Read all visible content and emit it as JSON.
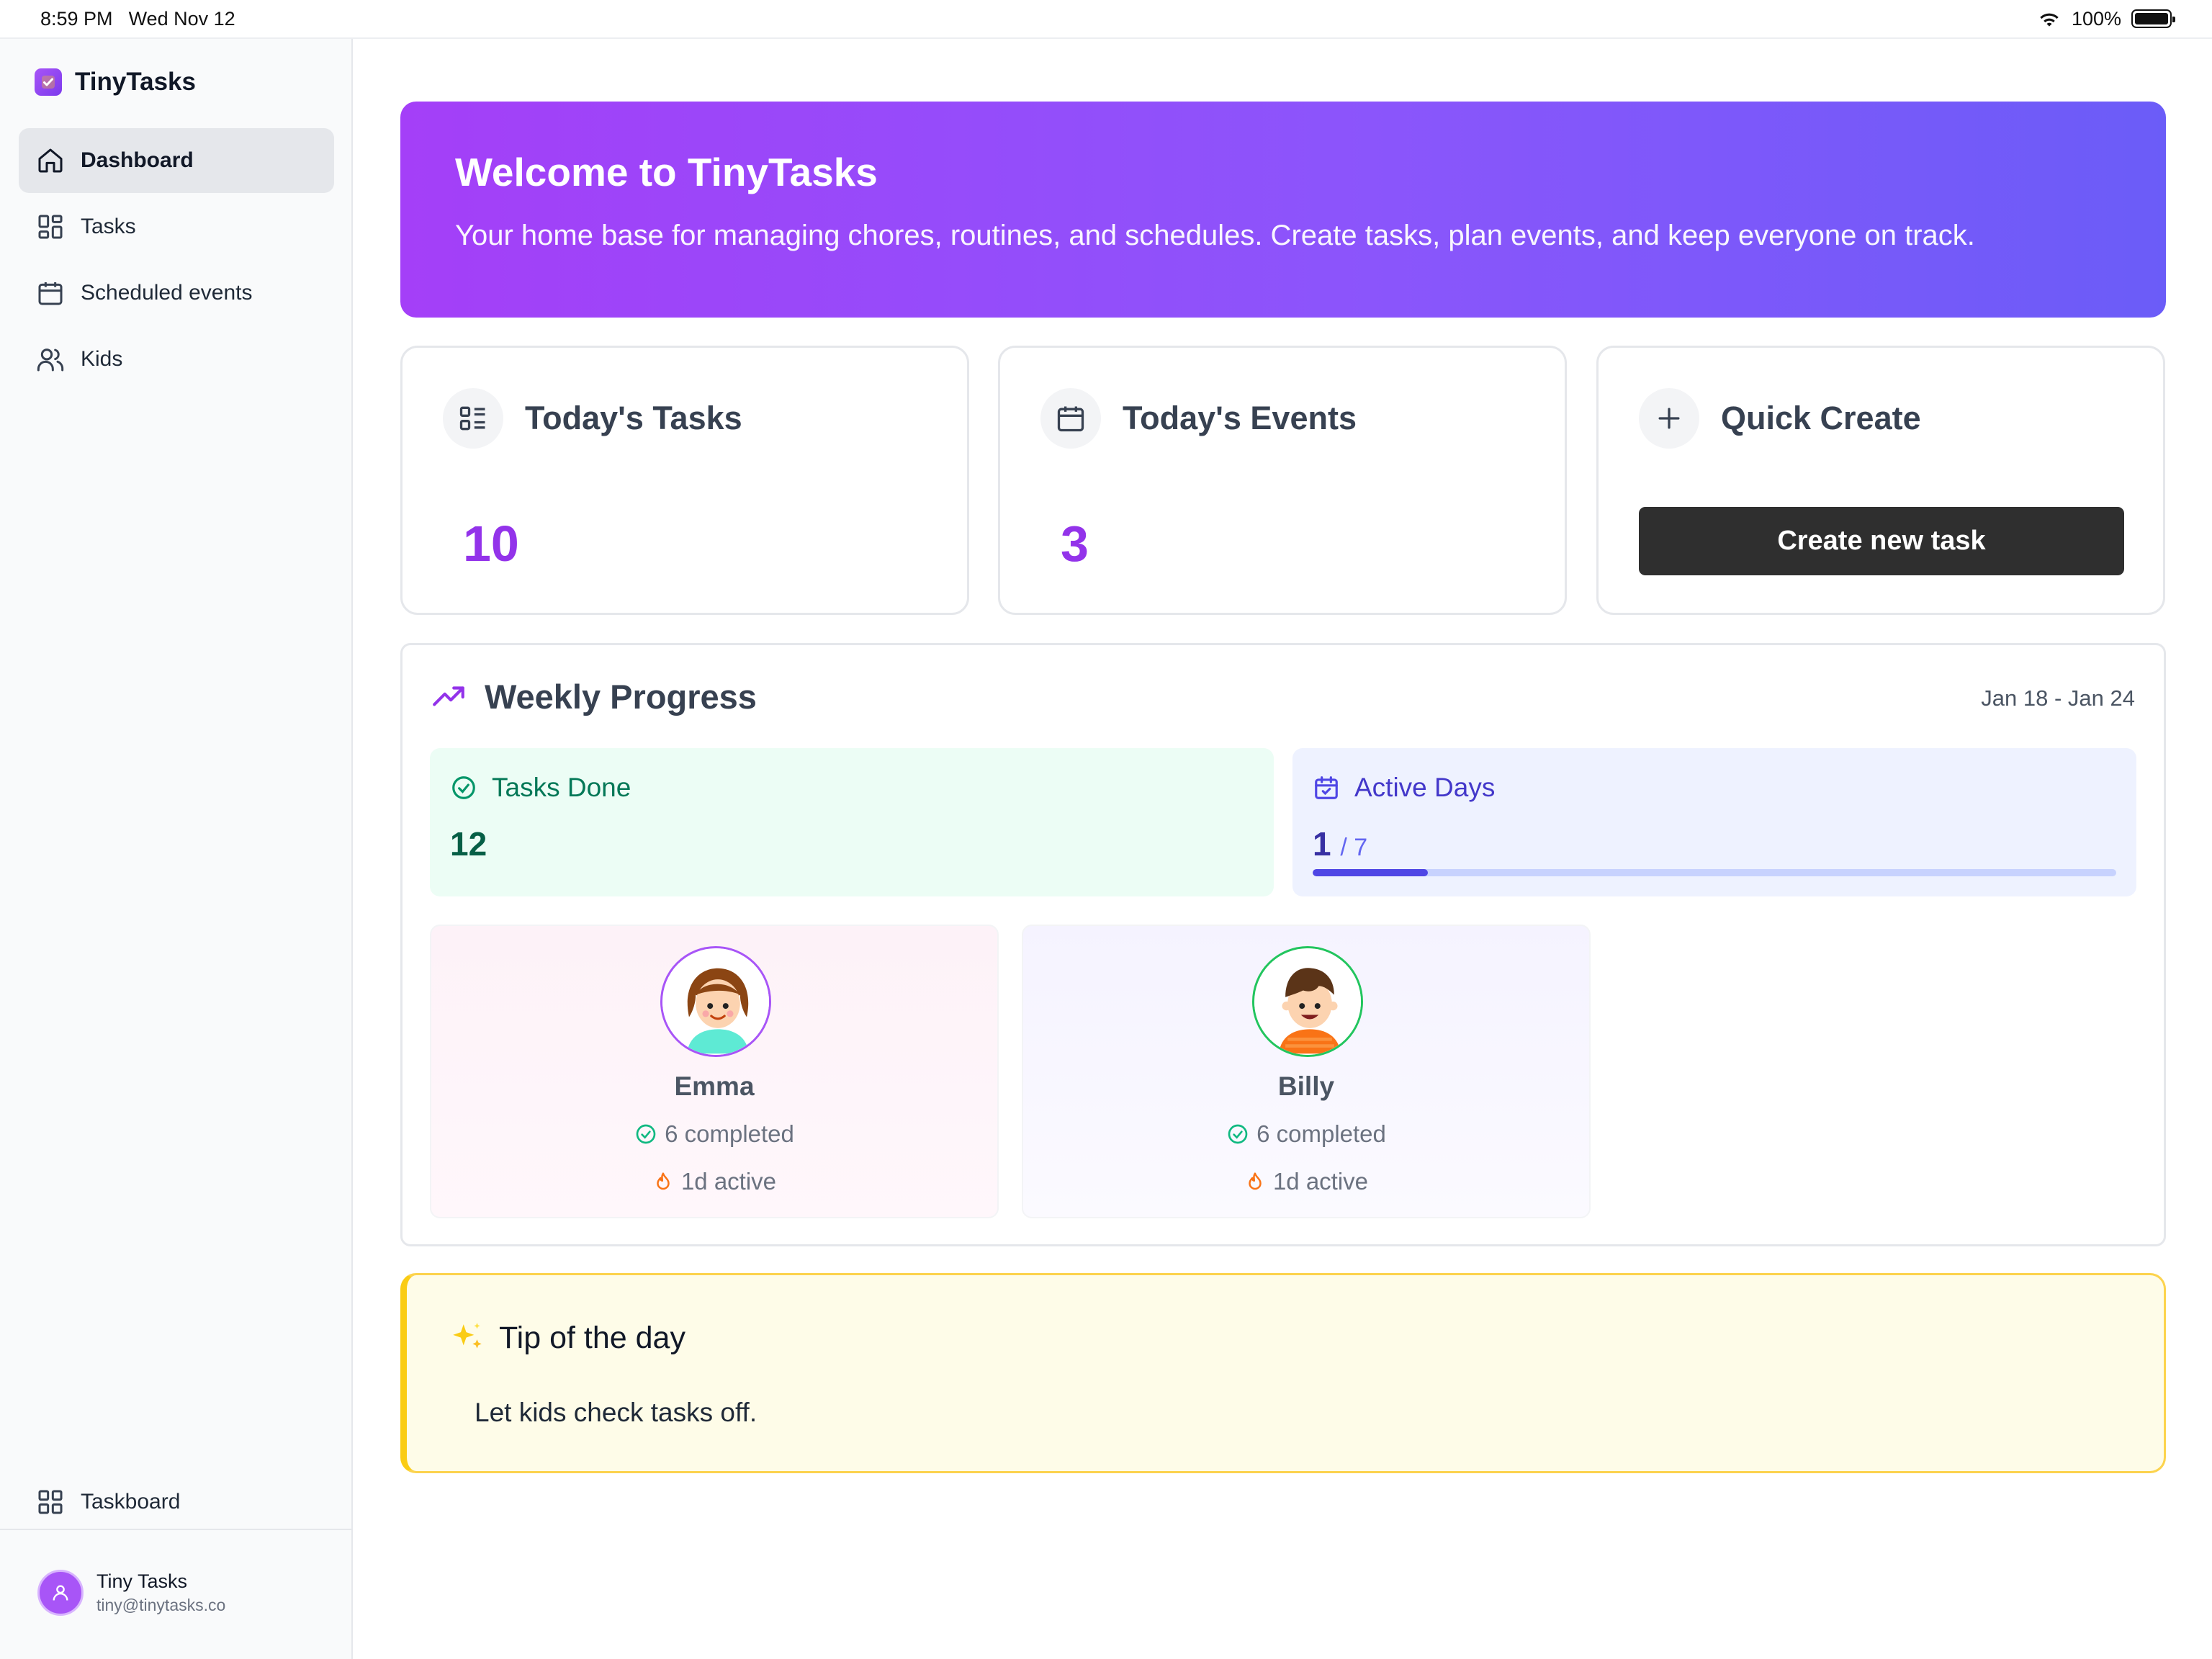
{
  "status_bar": {
    "time": "8:59 PM",
    "date": "Wed Nov 12",
    "battery": "100%"
  },
  "app": {
    "name": "TinyTasks"
  },
  "sidebar": {
    "items": [
      {
        "label": "Dashboard",
        "icon": "home-icon",
        "active": true
      },
      {
        "label": "Tasks",
        "icon": "grid-icon"
      },
      {
        "label": "Scheduled events",
        "icon": "calendar-icon"
      },
      {
        "label": "Kids",
        "icon": "users-icon"
      }
    ],
    "footer_item": {
      "label": "Taskboard",
      "icon": "grid-icon"
    },
    "profile": {
      "name": "Tiny Tasks",
      "email": "tiny@tinytasks.co"
    }
  },
  "hero": {
    "title": "Welcome to TinyTasks",
    "subtitle": "Your home base for managing chores, routines, and schedules. Create tasks, plan events, and keep everyone on track."
  },
  "cards": {
    "tasks": {
      "title": "Today's Tasks",
      "value": "10"
    },
    "events": {
      "title": "Today's Events",
      "value": "3"
    },
    "quick_create": {
      "title": "Quick Create",
      "button": "Create new task"
    }
  },
  "weekly": {
    "title": "Weekly Progress",
    "range": "Jan 18 - Jan 24",
    "tasks_done": {
      "label": "Tasks Done",
      "value": "12"
    },
    "active_days": {
      "label": "Active Days",
      "value": "1",
      "of": "/ 7",
      "progress": 0.143
    },
    "kids": [
      {
        "name": "Emma",
        "completed": "6 completed",
        "active": "1d active"
      },
      {
        "name": "Billy",
        "completed": "6 completed",
        "active": "1d active"
      }
    ]
  },
  "tip": {
    "title": "Tip of the day",
    "body": "Let kids check tasks off."
  },
  "colors": {
    "accent": "#9333ea",
    "hero_start": "#a43ff8",
    "hero_end": "#6b5cf8",
    "success": "#047857",
    "indigo": "#4338ca"
  }
}
